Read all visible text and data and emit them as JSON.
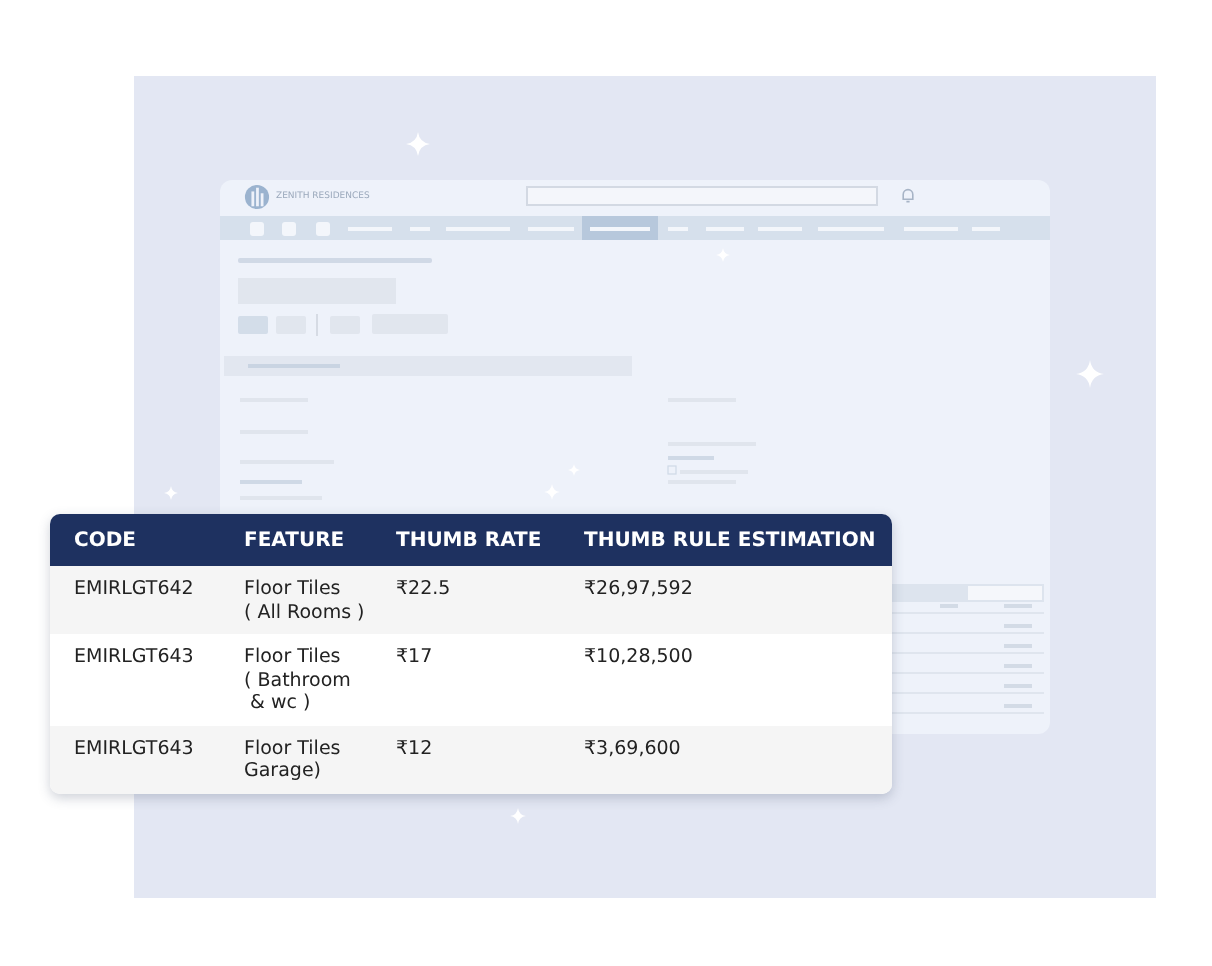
{
  "app_window": {
    "brand": "ZENITH RESIDENCES"
  },
  "table": {
    "columns": [
      "CODE",
      "FEATURE",
      "THUMB RATE",
      "THUMB RULE ESTIMATION"
    ],
    "rows": [
      {
        "code": "EMIRLGT642",
        "feature": "Floor Tiles\n( All Rooms )",
        "rate": "₹22.5",
        "estimation": "₹26,97,592"
      },
      {
        "code": "EMIRLGT643",
        "feature": "Floor Tiles\n( Bathroom\n & wc )",
        "rate": "₹17",
        "estimation": "₹10,28,500"
      },
      {
        "code": "EMIRLGT643",
        "feature": "Floor Tiles\nGarage)",
        "rate": "₹12",
        "estimation": "₹3,69,600"
      }
    ]
  }
}
